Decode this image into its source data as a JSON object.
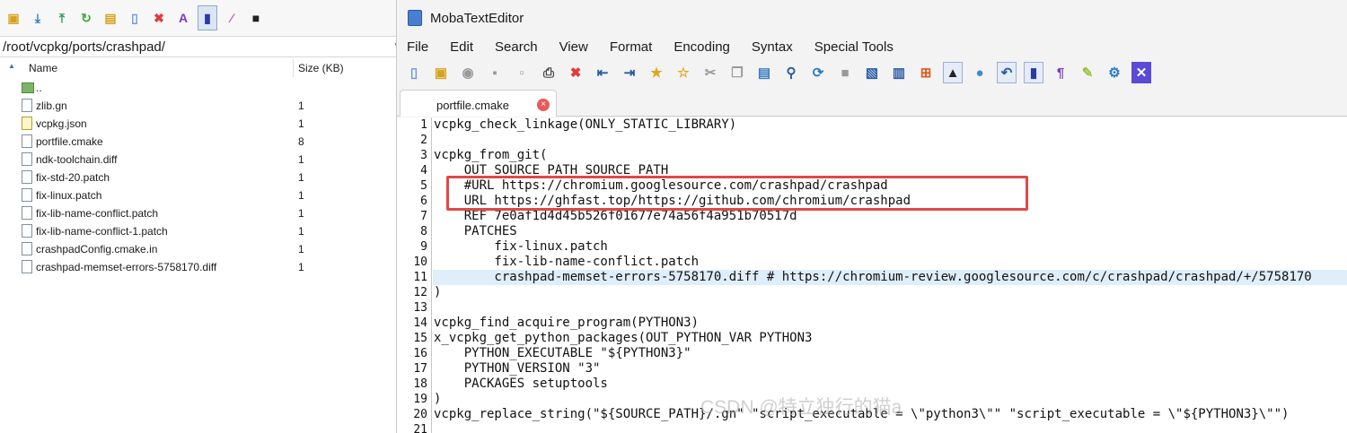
{
  "file_browser": {
    "path": "/root/vcpkg/ports/crashpad/",
    "columns": {
      "name": "Name",
      "size": "Size (KB)"
    },
    "toolbar_icons": [
      "folder-up-icon",
      "download-icon",
      "upload-icon",
      "refresh-icon",
      "new-folder-icon",
      "new-file-icon",
      "delete-icon",
      "rename-icon",
      "view-icon",
      "magic-wand-icon",
      "terminal-icon"
    ],
    "files": [
      {
        "name": "..",
        "size": "",
        "kind": "folder"
      },
      {
        "name": "zlib.gn",
        "size": "1",
        "kind": "file"
      },
      {
        "name": "vcpkg.json",
        "size": "1",
        "kind": "json"
      },
      {
        "name": "portfile.cmake",
        "size": "8",
        "kind": "file"
      },
      {
        "name": "ndk-toolchain.diff",
        "size": "1",
        "kind": "file"
      },
      {
        "name": "fix-std-20.patch",
        "size": "1",
        "kind": "file"
      },
      {
        "name": "fix-linux.patch",
        "size": "1",
        "kind": "file"
      },
      {
        "name": "fix-lib-name-conflict.patch",
        "size": "1",
        "kind": "file"
      },
      {
        "name": "fix-lib-name-conflict-1.patch",
        "size": "1",
        "kind": "file"
      },
      {
        "name": "crashpadConfig.cmake.in",
        "size": "1",
        "kind": "file"
      },
      {
        "name": "crashpad-memset-errors-5758170.diff",
        "size": "1",
        "kind": "file"
      }
    ]
  },
  "editor": {
    "title": "MobaTextEditor",
    "menu": [
      "File",
      "Edit",
      "Search",
      "View",
      "Format",
      "Encoding",
      "Syntax",
      "Special Tools"
    ],
    "tab": {
      "label": "portfile.cmake",
      "close": "×"
    },
    "lines": [
      {
        "n": "1",
        "text": "vcpkg_check_linkage(ONLY_STATIC_LIBRARY)"
      },
      {
        "n": "2",
        "text": ""
      },
      {
        "n": "3",
        "text": "vcpkg_from_git("
      },
      {
        "n": "4",
        "text": "    OUT_SOURCE_PATH SOURCE_PATH"
      },
      {
        "n": "5",
        "text": "    #URL https://chromium.googlesource.com/crashpad/crashpad"
      },
      {
        "n": "6",
        "text": "    URL https://ghfast.top/https://github.com/chromium/crashpad"
      },
      {
        "n": "7",
        "text": "    REF 7e0af1d4d45b526f01677e74a56f4a951b70517d"
      },
      {
        "n": "8",
        "text": "    PATCHES"
      },
      {
        "n": "9",
        "text": "        fix-linux.patch"
      },
      {
        "n": "10",
        "text": "        fix-lib-name-conflict.patch"
      },
      {
        "n": "11",
        "text": "        crashpad-memset-errors-5758170.diff # https://chromium-review.googlesource.com/c/crashpad/crashpad/+/5758170"
      },
      {
        "n": "12",
        "text": ")"
      },
      {
        "n": "13",
        "text": ""
      },
      {
        "n": "14",
        "text": "vcpkg_find_acquire_program(PYTHON3)"
      },
      {
        "n": "15",
        "text": "x_vcpkg_get_python_packages(OUT_PYTHON_VAR PYTHON3"
      },
      {
        "n": "16",
        "text": "    PYTHON_EXECUTABLE \"${PYTHON3}\""
      },
      {
        "n": "17",
        "text": "    PYTHON_VERSION \"3\""
      },
      {
        "n": "18",
        "text": "    PACKAGES setuptools"
      },
      {
        "n": "19",
        "text": ")"
      },
      {
        "n": "20",
        "text": "vcpkg_replace_string(\"${SOURCE_PATH}/.gn\" \"script_executable = \\\"python3\\\"\" \"script_executable = \\\"${PYTHON3}\\\"\")"
      },
      {
        "n": "21",
        "text": ""
      }
    ],
    "highlighted_line": "11"
  },
  "watermark": "CSDN @特立独行的猫a",
  "colors": {
    "highlight": "#dfeefb",
    "annotation_box": "#e04848",
    "accent": "#3a6fb0"
  }
}
